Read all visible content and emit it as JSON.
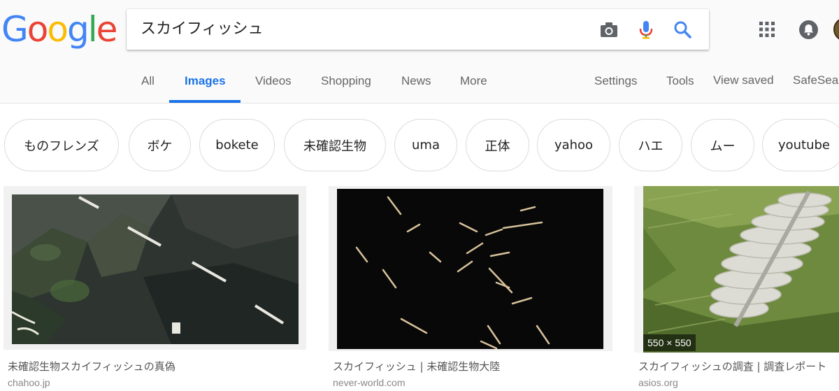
{
  "search": {
    "query": "スカイフィッシュ"
  },
  "logo": {
    "letters": [
      "G",
      "o",
      "o",
      "g",
      "l",
      "e"
    ],
    "colors": [
      "#4285f4",
      "#ea4335",
      "#fbbc05",
      "#4285f4",
      "#34a853",
      "#ea4335"
    ]
  },
  "icons": {
    "camera": "camera-icon",
    "mic": "mic-icon",
    "search": "search-icon",
    "apps": "apps-grid-icon",
    "notifications": "bell-icon"
  },
  "nav": {
    "tabs": [
      "All",
      "Images",
      "Videos",
      "Shopping",
      "News",
      "More"
    ],
    "active_tab": "Images",
    "right": [
      "Settings",
      "Tools",
      "View saved",
      "SafeSearch"
    ]
  },
  "chips": [
    "ものフレンズ",
    "ボケ",
    "bokete",
    "未確認生物",
    "uma",
    "正体",
    "yahoo",
    "ハエ",
    "ムー",
    "youtube"
  ],
  "results": [
    {
      "title": "未確認生物スカイフィッシュの真偽",
      "domain": "chahoo.jp"
    },
    {
      "title": "スカイフィッシュ | 未確認生物大陸",
      "domain": "never-world.com"
    },
    {
      "title": "スカイフィッシュの調査 | 調査レポート",
      "domain": "asios.org",
      "dimensions": "550 × 550"
    }
  ],
  "colors": {
    "accent": "#1a73e8",
    "text_secondary": "#666666"
  }
}
